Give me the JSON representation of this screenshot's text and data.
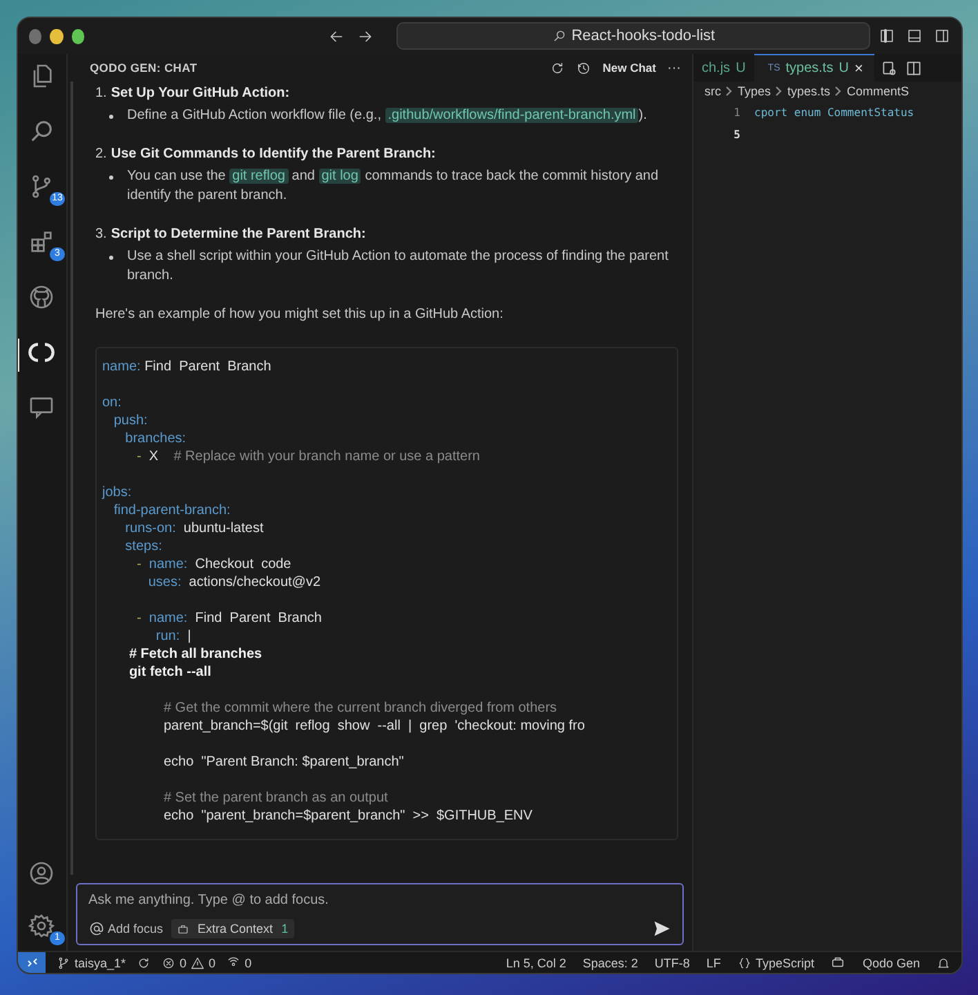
{
  "window": {
    "search": "React-hooks-todo-list"
  },
  "activity_bar": {
    "items": [
      {
        "kind": "files",
        "selected": false
      },
      {
        "kind": "search",
        "selected": false
      },
      {
        "kind": "source-control",
        "selected": false,
        "badge": "13"
      },
      {
        "kind": "extensions",
        "selected": false,
        "badge": "3"
      },
      {
        "kind": "github",
        "selected": false
      },
      {
        "kind": "qodo",
        "selected": true
      },
      {
        "kind": "chat",
        "selected": false
      }
    ],
    "bottom": [
      {
        "kind": "account"
      },
      {
        "kind": "settings",
        "badge": "1"
      }
    ]
  },
  "chat": {
    "title": "QODO GEN: CHAT",
    "new_chat": "New Chat",
    "more": "···",
    "steps": [
      {
        "number": "1.",
        "title": "Set Up Your GitHub Action:",
        "bullet": [
          {
            "text": "Define a GitHub Action workflow file (e.g., "
          },
          {
            "code": ".github/workflows/find-parent-branch.yml"
          },
          {
            "text": ")."
          }
        ]
      },
      {
        "number": "2.",
        "title": "Use Git Commands to Identify the Parent Branch:",
        "bullet": [
          {
            "text": "You can use the "
          },
          {
            "code": "git reflog"
          },
          {
            "text": " and "
          },
          {
            "code": "git log"
          },
          {
            "text": " commands to trace back the commit history and identify the parent branch."
          }
        ]
      },
      {
        "number": "3.",
        "title": "Script to Determine the Parent Branch:",
        "bullet": [
          {
            "text": "Use a shell script within your GitHub Action to automate the process of finding the parent branch."
          }
        ]
      }
    ],
    "intro": "Here's an example of how you might set this up in a GitHub Action:",
    "code": [
      {
        "kind": "code",
        "tokens": [
          {
            "kind": "key",
            "text": "name:"
          },
          {
            "kind": "value",
            "text": " Find  Parent  Branch"
          }
        ]
      },
      {
        "kind": "blank"
      },
      {
        "kind": "code",
        "tokens": [
          {
            "kind": "key",
            "text": "on:"
          }
        ]
      },
      {
        "kind": "code",
        "tokens": [
          {
            "kind": "key",
            "text": "   push:"
          }
        ]
      },
      {
        "kind": "code",
        "tokens": [
          {
            "kind": "key",
            "text": "      branches:"
          }
        ]
      },
      {
        "kind": "code",
        "tokens": [
          {
            "kind": "dash",
            "text": "         -"
          },
          {
            "kind": "value",
            "text": "  X"
          },
          {
            "kind": "comment",
            "text": "    # Replace with your branch name or use a pattern"
          }
        ]
      },
      {
        "kind": "blank"
      },
      {
        "kind": "code",
        "tokens": [
          {
            "kind": "key",
            "text": "jobs:"
          }
        ]
      },
      {
        "kind": "code",
        "tokens": [
          {
            "kind": "key",
            "text": "   find-parent-branch:"
          }
        ]
      },
      {
        "kind": "code",
        "tokens": [
          {
            "kind": "key",
            "text": "      runs-on:"
          },
          {
            "kind": "value",
            "text": "  ubuntu-latest"
          }
        ]
      },
      {
        "kind": "code",
        "tokens": [
          {
            "kind": "key",
            "text": "      steps:"
          }
        ]
      },
      {
        "kind": "code",
        "tokens": [
          {
            "kind": "dash",
            "text": "         -"
          },
          {
            "kind": "key",
            "text": "  name:"
          },
          {
            "kind": "value",
            "text": "  Checkout  code"
          }
        ]
      },
      {
        "kind": "code",
        "tokens": [
          {
            "kind": "key",
            "text": "            uses:"
          },
          {
            "kind": "value",
            "text": "  actions/checkout@v2"
          }
        ]
      },
      {
        "kind": "blank"
      },
      {
        "kind": "code",
        "tokens": [
          {
            "kind": "dash",
            "text": "         -"
          },
          {
            "kind": "key",
            "text": "  name:"
          },
          {
            "kind": "value",
            "text": "  Find  Parent  Branch"
          }
        ]
      },
      {
        "kind": "code",
        "tokens": [
          {
            "kind": "key",
            "text": "              run:"
          },
          {
            "kind": "value",
            "text": "  |"
          }
        ]
      },
      {
        "kind": "code",
        "tokens": [
          {
            "kind": "shell",
            "text": "       # Fetch all branches"
          }
        ]
      },
      {
        "kind": "code",
        "tokens": [
          {
            "kind": "shell",
            "text": "       git fetch --all"
          }
        ]
      },
      {
        "kind": "blank"
      },
      {
        "kind": "code",
        "tokens": [
          {
            "kind": "comment",
            "text": "                # Get the commit where the current branch diverged from others"
          }
        ]
      },
      {
        "kind": "code",
        "tokens": [
          {
            "kind": "value",
            "text": "                parent_branch=$(git  reflog  show  --all  |  grep  'checkout: moving fro"
          }
        ]
      },
      {
        "kind": "blank"
      },
      {
        "kind": "code",
        "tokens": [
          {
            "kind": "value",
            "text": "                echo  \"Parent Branch: $parent_branch\""
          }
        ]
      },
      {
        "kind": "blank"
      },
      {
        "kind": "code",
        "tokens": [
          {
            "kind": "comment",
            "text": "                # Set the parent branch as an output"
          }
        ]
      },
      {
        "kind": "code",
        "tokens": [
          {
            "kind": "value",
            "text": "                echo  \"parent_branch=$parent_branch\"  >>  $GITHUB_ENV"
          }
        ]
      }
    ],
    "input": {
      "placeholder": "Ask me anything. Type @ to add focus.",
      "add_focus": "Add focus",
      "context_label": "Extra Context",
      "context_count": "1"
    }
  },
  "editor": {
    "tabs": [
      {
        "label": "ch.js",
        "status": "U",
        "selected": false
      },
      {
        "label": "types.ts",
        "status": "U",
        "selected": true,
        "lang": "TS"
      }
    ],
    "close": "×",
    "breadcrumb": [
      "src",
      "Types",
      "types.ts",
      "CommentS"
    ],
    "lines": [
      {
        "number": "1",
        "text": "cport enum CommentStatus"
      },
      {
        "number": "5"
      }
    ]
  },
  "status_bar": {
    "branch": "taisya_1*",
    "errors": "0",
    "warnings": "0",
    "ports": "0",
    "position": "Ln 5, Col 2",
    "spaces": "Spaces: 2",
    "encoding": "UTF-8",
    "eol": "LF",
    "language": "TypeScript",
    "extension": "Qodo Gen"
  }
}
